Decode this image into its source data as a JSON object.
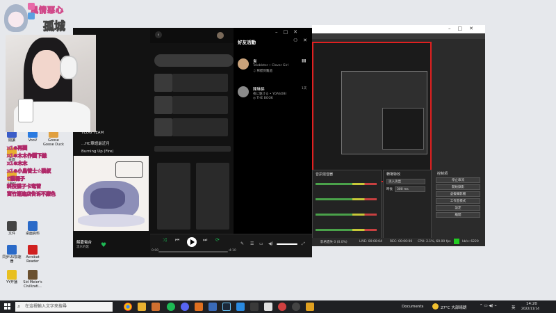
{
  "stream_overlay": {
    "title_line1": "風情惡心",
    "title_line2": "孤城",
    "chat_lines": [
      "x1⊕再圖",
      "x1⊕木木作圖下線",
      "x1⊕木木",
      "x1⊕小鳥管士★猫叔",
      "6猫裸子",
      "科技猫子卡竜管",
      "富竹連進店告诉不廉色"
    ]
  },
  "desktop_icons": [
    {
      "label": "閱讀",
      "color": "#3a5cc8"
    },
    {
      "label": "VooV",
      "color": "#2a7ae0"
    },
    {
      "label": "Goose Goose Duck",
      "color": "#e0a040"
    },
    {
      "label": "桌面",
      "color": "#e8b030"
    },
    {
      "label": "User",
      "color": "#e8b030"
    },
    {
      "label": "文件",
      "color": "#444"
    },
    {
      "label": "桌面資料",
      "color": "#2a6ac8"
    },
    {
      "label": "同步UU加速器",
      "color": "#2a6ac8"
    },
    {
      "label": "Acrobat Reader",
      "color": "#d02020"
    },
    {
      "label": "YY开播",
      "color": "#e8c020"
    },
    {
      "label": "Sid Meier's Civilizati...",
      "color": "#6a5030"
    }
  ],
  "spotify_menu": {
    "items": [
      "VLOG TEAM",
      "...HC華語最近月",
      "Burning Up (Fire)"
    ]
  },
  "spotify": {
    "friend_activity_title": "好友活動",
    "friends": [
      {
        "name": "貴",
        "track": "Teleblster • Clover Girl",
        "source": "♫ 稀聽到難過",
        "time": "",
        "color": "#c9a27a"
      },
      {
        "name": "陳琳錦",
        "track": "夜に駆ける • YOASOBI",
        "source": "◎ THE BOOK",
        "time": "1天",
        "color": "#8a8a8a"
      }
    ],
    "now_playing": {
      "title": "解憂電台",
      "artist": "溫水的歌"
    },
    "time_elapsed": "0:00",
    "time_total": "-4:10"
  },
  "obs": {
    "mixer_title": "音訊混音器",
    "transition_title": "轉場特效",
    "transition_value": "淡入淡出",
    "duration_label": "時長",
    "duration_value": "300 ms",
    "controls_title": "控制項",
    "controls": [
      "停止串流",
      "開始錄影",
      "虛擬攝影機",
      "工作室模式",
      "設定",
      "離開"
    ],
    "status": {
      "dropped": "影格遺失 0 (0.0%)",
      "live": "LIVE: 00:00:04",
      "rec": "REC: 00:00:00",
      "cpu": "CPU: 2.1%, 60.00 fps",
      "kbps": "kb/s: 6220"
    },
    "accent_red": "#e02020"
  },
  "taskbar": {
    "search_placeholder": "在這裡輸入文字來搜尋",
    "documents": "Documents",
    "weather": "27°C 大部晴朗",
    "lang": "英",
    "time": "14:20",
    "date": "2022/11/14"
  }
}
